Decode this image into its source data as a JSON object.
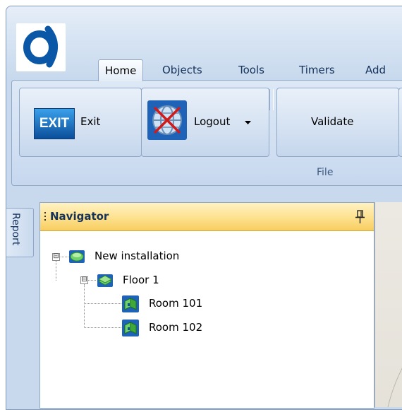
{
  "app": {
    "logo_icon": "app-logo-icon"
  },
  "tabs": [
    {
      "label": "Home",
      "active": true
    },
    {
      "label": "Objects",
      "active": false
    },
    {
      "label": "Tools",
      "active": false
    },
    {
      "label": "Timers",
      "active": false
    },
    {
      "label": "Add",
      "active": false
    }
  ],
  "ribbon": {
    "exit": {
      "label": "Exit",
      "icon_text": "EXIT",
      "icon": "exit-icon"
    },
    "logout": {
      "label": "Logout",
      "icon": "globe-disconnect-icon",
      "dropdown_icon": "dropdown-arrow-icon"
    },
    "validate": {
      "label": "Validate"
    },
    "group_label": "File"
  },
  "side_tabs": {
    "report": "Report"
  },
  "navigator": {
    "title": "Navigator",
    "pin_icon": "pin-icon",
    "tree": [
      {
        "label": "New installation",
        "icon": "installation-icon",
        "expander": "⊟"
      },
      {
        "label": "Floor 1",
        "icon": "floor-icon",
        "expander": "⊟"
      },
      {
        "label": "Room 101",
        "icon": "room-icon"
      },
      {
        "label": "Room 102",
        "icon": "room-icon"
      }
    ]
  }
}
